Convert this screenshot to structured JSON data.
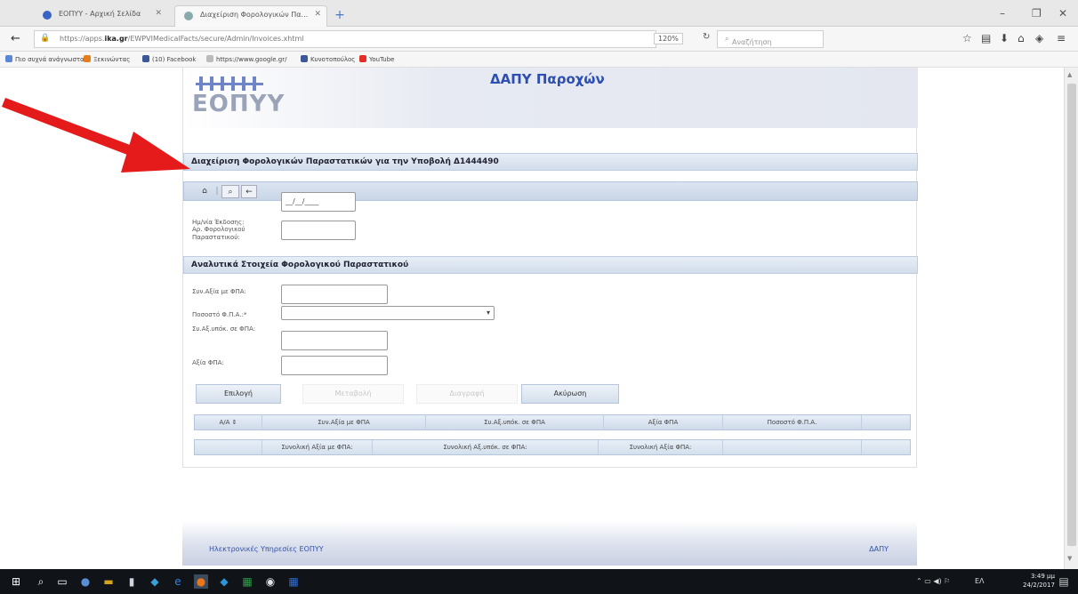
{
  "browser": {
    "tabs": [
      {
        "label": "ΕΟΠΥΥ - Αρχική Σελίδα"
      },
      {
        "label": "Διαχείριση Φορολογικών Πα..."
      }
    ],
    "url_prefix": "https://apps.",
    "url_domain": "ika.gr",
    "url_rest": "/EWPVIMedicalFacts/secure/Admin/Invoices.xhtml",
    "zoom": "120%",
    "search_placeholder": "Αναζήτηση",
    "bookmarks": [
      "Πιο συχνά ανάγνωστα",
      "Ξεκινώντας",
      "(10) Facebook",
      "https://www.google.gr/",
      "Κυνοτοπούλος",
      "YouTube"
    ]
  },
  "header": {
    "logo": "ΕΟΠΥΥ",
    "brand": "ΔΑΠΥ Παροχών"
  },
  "section1": {
    "title": "Διαχείριση Φορολογικών Παραστατικών για την Υποβολή Δ1444490"
  },
  "toolbar": {
    "home_glyph": "⌂",
    "separator": "|",
    "search_glyph": "⌕",
    "back_glyph": "←"
  },
  "form1": {
    "date_label": "Ημ/νία Έκδοσης:",
    "date_value": "__/__/____",
    "number_label": "Αρ. Φορολογικού Παραστατικού:"
  },
  "section2": {
    "title": "Αναλυτικά Στοιχεία Φορολογικού Παραστατικού"
  },
  "form2": {
    "total_vat_label": "Συν.Αξία με ΦΠΑ:",
    "vat_percent_label": "Ποσοστό Φ.Π.Α.:*",
    "subject_label": "Συ.Αξ.υπόκ. σε ΦΠΑ:",
    "vat_value_label": "Αξία ΦΠΑ:"
  },
  "actions": {
    "select": "Επιλογή",
    "edit": "Μεταβολή",
    "delete": "Διαγραφή",
    "cancel": "Ακύρωση"
  },
  "table": {
    "headers": [
      "Α/Α ⇕",
      "Συν.Αξία με ΦΠΑ",
      "Συ.Αξ.υπόκ. σε ΦΠΑ",
      "Αξία ΦΠΑ",
      "Ποσοστό Φ.Π.Α.",
      ""
    ],
    "footer": [
      "",
      "Συνολική Αξία με ΦΠΑ:",
      "Συνολική Αξ.υπόκ. σε ΦΠΑ:",
      "Συνολική Αξία ΦΠΑ:",
      "",
      ""
    ]
  },
  "footer": {
    "left": "Ηλεκτρονικές Υπηρεσίες ΕΟΠΥΥ",
    "right": "ΔΑΠΥ"
  },
  "taskbar": {
    "tray": "ΕΛ",
    "time": "3:49 μμ",
    "date": "24/2/2017"
  },
  "colors": {
    "accent_blue": "#2c4fb3",
    "arrow_red": "#e51a1a",
    "header_band": "#d2ddeb"
  }
}
